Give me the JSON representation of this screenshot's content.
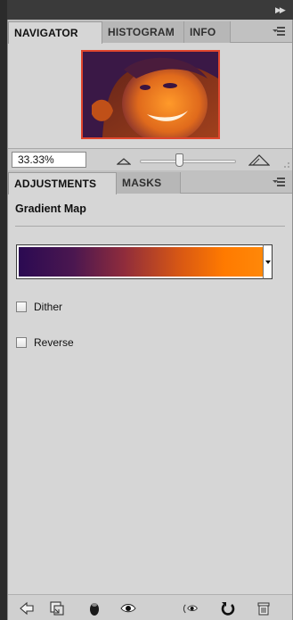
{
  "navigator_panel": {
    "tabs": [
      {
        "label": "NAVIGATOR",
        "active": true
      },
      {
        "label": "HISTOGRAM",
        "active": false
      },
      {
        "label": "INFO",
        "active": false
      }
    ],
    "zoom_value": "33.33%",
    "preview_icon": "photo-thumbnail",
    "view_box_color": "#e0462e"
  },
  "adjustments_panel": {
    "tabs": [
      {
        "label": "ADJUSTMENTS",
        "active": true
      },
      {
        "label": "MASKS",
        "active": false
      }
    ],
    "title": "Gradient Map",
    "gradient_colors": [
      "#2b0a52",
      "#ff8a0a"
    ],
    "options": [
      {
        "label": "Dither",
        "checked": false
      },
      {
        "label": "Reverse",
        "checked": false
      }
    ],
    "footer_icons": [
      "back-arrow-icon",
      "clip-to-layer-icon",
      "layer-visibility-icon",
      "eye-icon",
      "previous-state-icon",
      "reset-icon",
      "trash-icon"
    ]
  }
}
